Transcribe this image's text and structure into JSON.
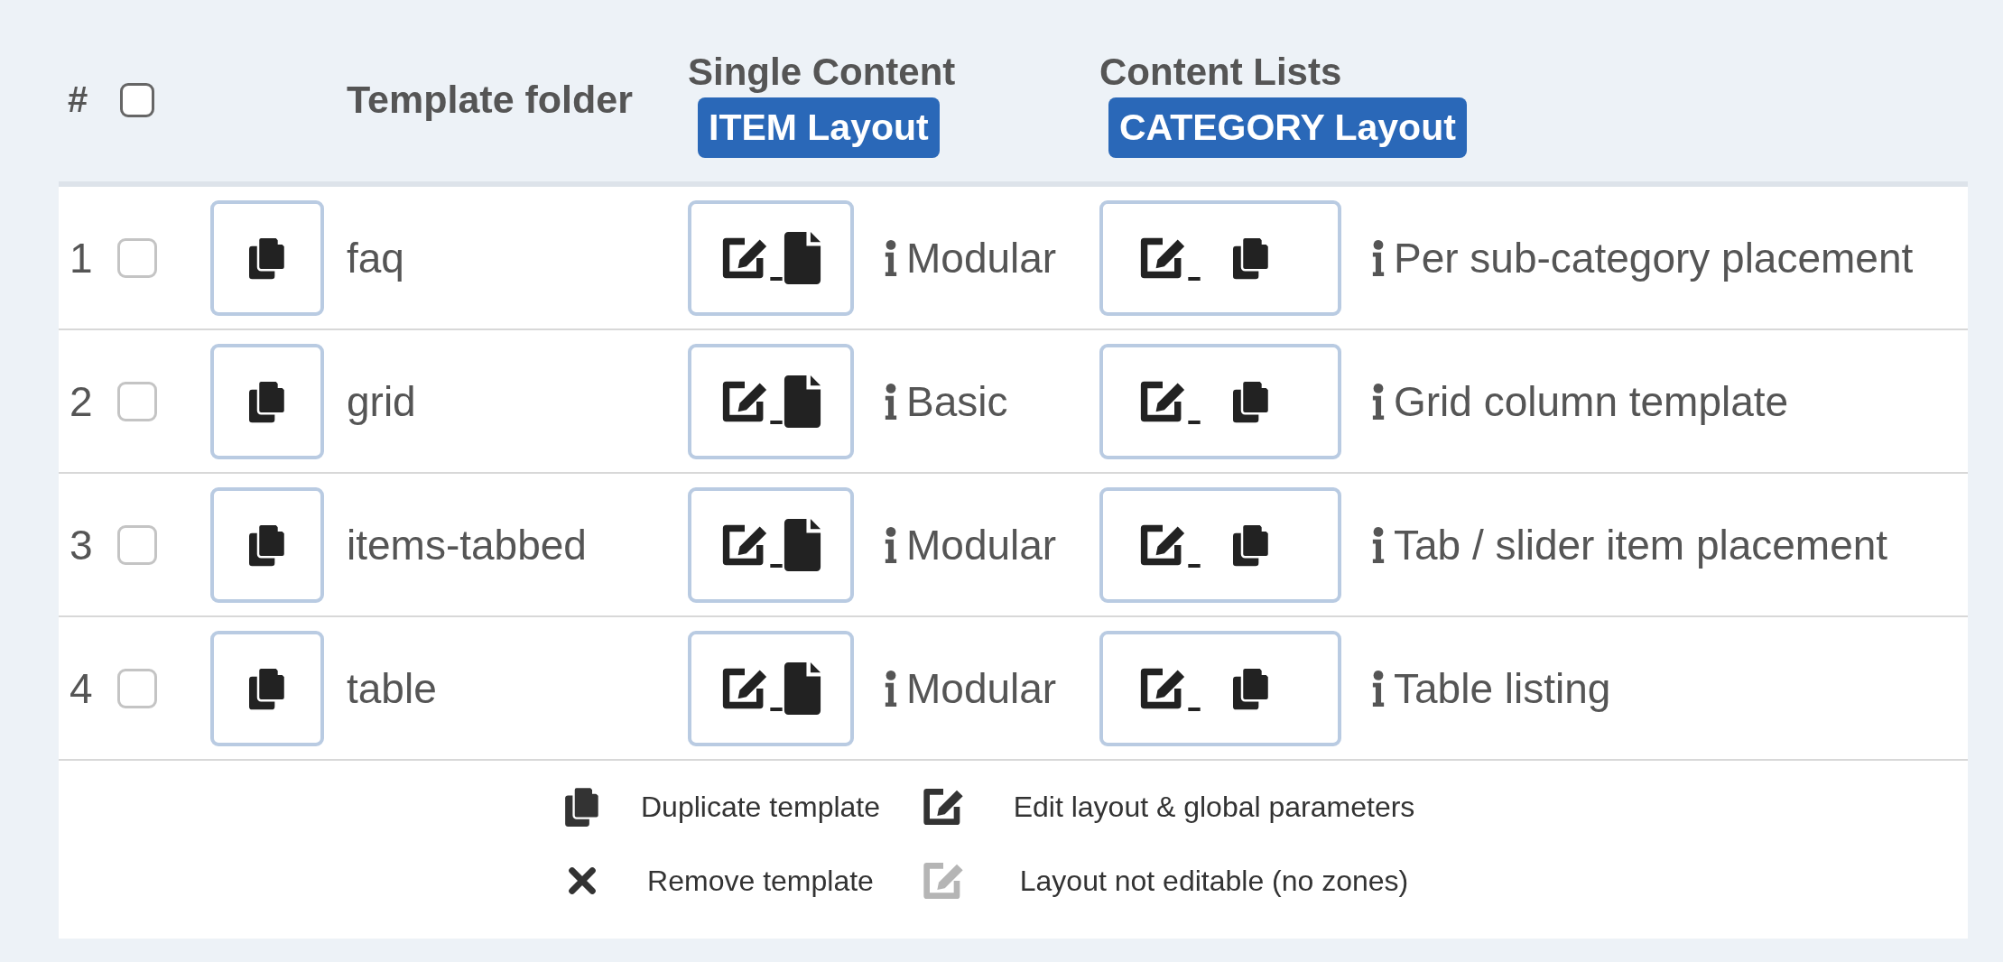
{
  "header": {
    "number": "#",
    "select_all": {
      "checked": false
    },
    "folder": "Template folder",
    "single": {
      "title": "Single Content",
      "badge": "ITEM Layout"
    },
    "lists": {
      "title": "Content Lists",
      "badge": "CATEGORY Layout"
    }
  },
  "rows": [
    {
      "number": "1",
      "checked": false,
      "folder": "faq",
      "item_layout": "Modular",
      "category_layout": "Per sub-category placement"
    },
    {
      "number": "2",
      "checked": false,
      "folder": "grid",
      "item_layout": "Basic",
      "category_layout": "Grid column template"
    },
    {
      "number": "3",
      "checked": false,
      "folder": "items-tabbed",
      "item_layout": "Modular",
      "category_layout": "Tab / slider item placement"
    },
    {
      "number": "4",
      "checked": false,
      "folder": "table",
      "item_layout": "Modular",
      "category_layout": "Table listing"
    }
  ],
  "legend": [
    {
      "kind": "duplicate",
      "label": "Duplicate template"
    },
    {
      "kind": "edit",
      "label": "Edit layout & global parameters"
    },
    {
      "kind": "remove",
      "label": "Remove template"
    },
    {
      "kind": "edit-disabled",
      "label": "Layout not editable (no zones)"
    }
  ]
}
